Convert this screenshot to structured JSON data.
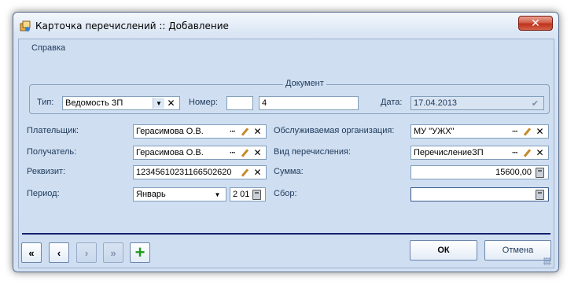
{
  "window": {
    "title": "Карточка перечислений :: Добавление",
    "close_glyph": "✕",
    "icon": "app-card-icon"
  },
  "menu": {
    "help": "Справка"
  },
  "document_group": {
    "legend": "Документ",
    "type_label": "Тип:",
    "type_value": "Ведомость ЗП",
    "number_label": "Номер:",
    "number_prefix": "",
    "number_value": "4",
    "date_label": "Дата:",
    "date_value": "17.04.2013"
  },
  "form": {
    "payer_label": "Плательщик:",
    "payer_value": "Герасимова О.В.",
    "recipient_label": "Получатель:",
    "recipient_value": "Герасимова О.В.",
    "requisite_label": "Реквизит:",
    "requisite_value": "12345610231166502620",
    "period_label": "Период:",
    "period_month": "Январь",
    "period_year": "2 01",
    "org_label": "Обслуживаемая организация:",
    "org_value": "МУ \"УЖХ\"",
    "transfer_type_label": "Вид перечисления:",
    "transfer_type_value": "ПеречислениеЗП",
    "amount_label": "Сумма:",
    "amount_value": "15600,00",
    "fee_label": "Сбор:",
    "fee_value": ""
  },
  "buttons": {
    "first": "«",
    "prev": "‹",
    "next": "›",
    "last": "»",
    "add": "+",
    "ok": "ОК",
    "cancel": "Отмена"
  },
  "colors": {
    "accent": "#15216e",
    "add_green": "#1f9a1f",
    "close_red": "#c2321a"
  }
}
